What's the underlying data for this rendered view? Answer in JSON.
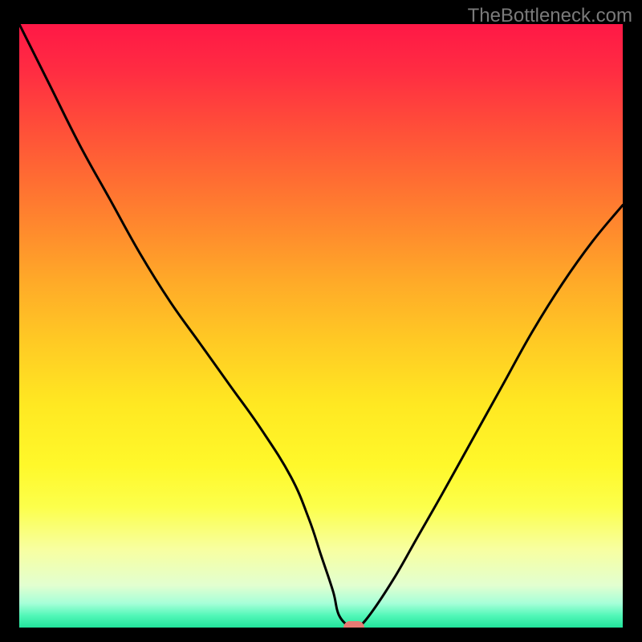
{
  "watermark": "TheBottleneck.com",
  "colors": {
    "curve": "#000000",
    "marker": "#e77a74",
    "page_bg": "#000000"
  },
  "chart_data": {
    "type": "line",
    "title": "",
    "xlabel": "",
    "ylabel": "",
    "xlim": [
      0,
      100
    ],
    "ylim": [
      0,
      100
    ],
    "grid": false,
    "legend": false,
    "series": [
      {
        "name": "bottleneck-curve",
        "x": [
          0,
          5,
          10,
          15,
          20,
          25,
          30,
          35,
          40,
          45,
          48,
          50,
          52,
          53,
          55,
          56,
          58,
          62,
          66,
          70,
          75,
          80,
          85,
          90,
          95,
          100
        ],
        "y": [
          100,
          90,
          80,
          71,
          62,
          54,
          47,
          40,
          33,
          25,
          18,
          12,
          6,
          2,
          0,
          0,
          2,
          8,
          15,
          22,
          31,
          40,
          49,
          57,
          64,
          70
        ]
      }
    ],
    "marker": {
      "x": 55.5,
      "y": 0
    },
    "background_gradient": [
      {
        "stop": 0,
        "color": "#ff1846"
      },
      {
        "stop": 50,
        "color": "#ffcb24"
      },
      {
        "stop": 80,
        "color": "#fcff4b"
      },
      {
        "stop": 100,
        "color": "#22e39b"
      }
    ]
  }
}
